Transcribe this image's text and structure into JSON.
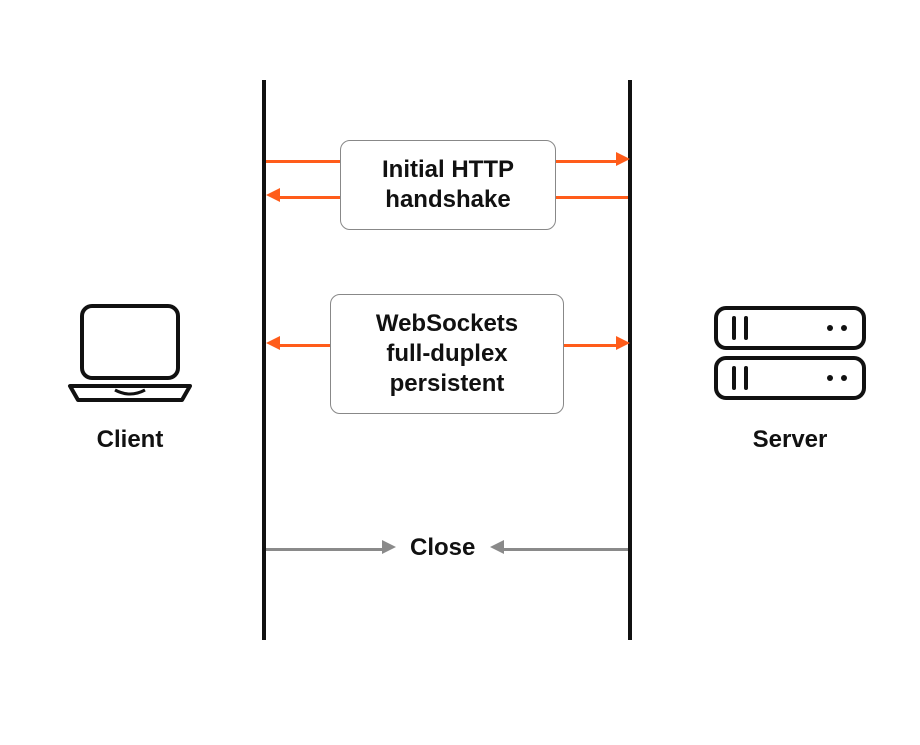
{
  "client": {
    "label": "Client"
  },
  "server": {
    "label": "Server"
  },
  "handshake_box": {
    "line1": "Initial HTTP",
    "line2": "handshake"
  },
  "websocket_box": {
    "line1": "WebSockets",
    "line2": "full-duplex",
    "line3": "persistent"
  },
  "close_label": "Close",
  "colors": {
    "arrow_primary": "#ff5c1a",
    "arrow_secondary": "#8a8a8a",
    "line": "#111111"
  }
}
